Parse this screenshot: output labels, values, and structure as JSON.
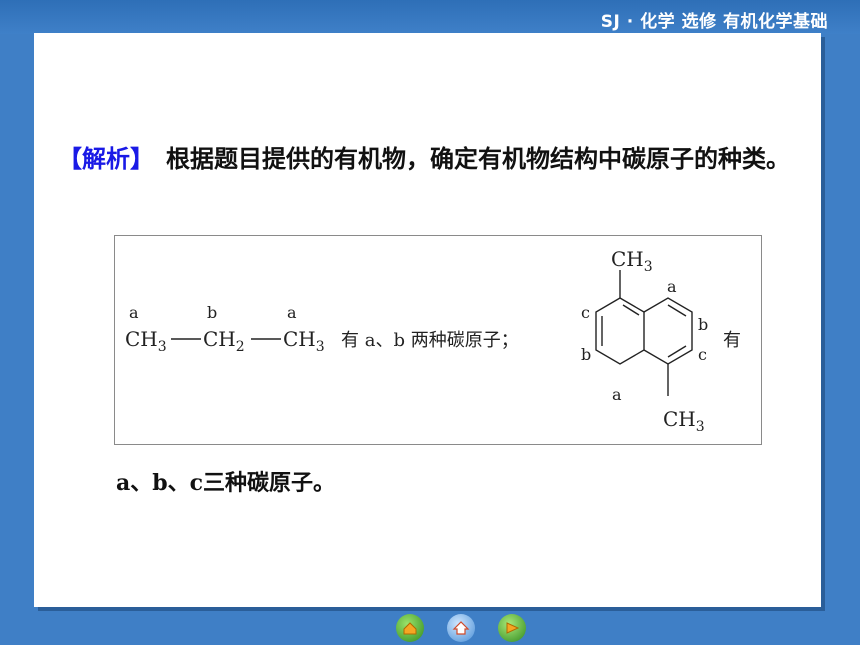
{
  "header": {
    "title": "SJ · 化学  选修  有机化学基础"
  },
  "content": {
    "label": "【解析】",
    "para1_text": "　根据题目提供的有机物，确定有机物结构中碳原子的种类。",
    "para3_text": "a、b、c三种碳原子。"
  },
  "figure": {
    "propane": {
      "labels": [
        "a",
        "b",
        "a"
      ],
      "groups": [
        "CH",
        "CH",
        "CH"
      ],
      "subs": [
        "3",
        "2",
        "3"
      ],
      "bond": "—",
      "tail": "有 a、b 两种碳原子；"
    },
    "naphthalene": {
      "top_group": "CH",
      "top_sub": "3",
      "bottom_group": "CH",
      "bottom_sub": "3",
      "labels": [
        "a",
        "b",
        "c",
        "c",
        "b",
        "a"
      ],
      "tail": "有"
    }
  },
  "nav": {
    "home_icon": "home-icon",
    "back_icon": "back-icon",
    "next_icon": "next-icon"
  }
}
